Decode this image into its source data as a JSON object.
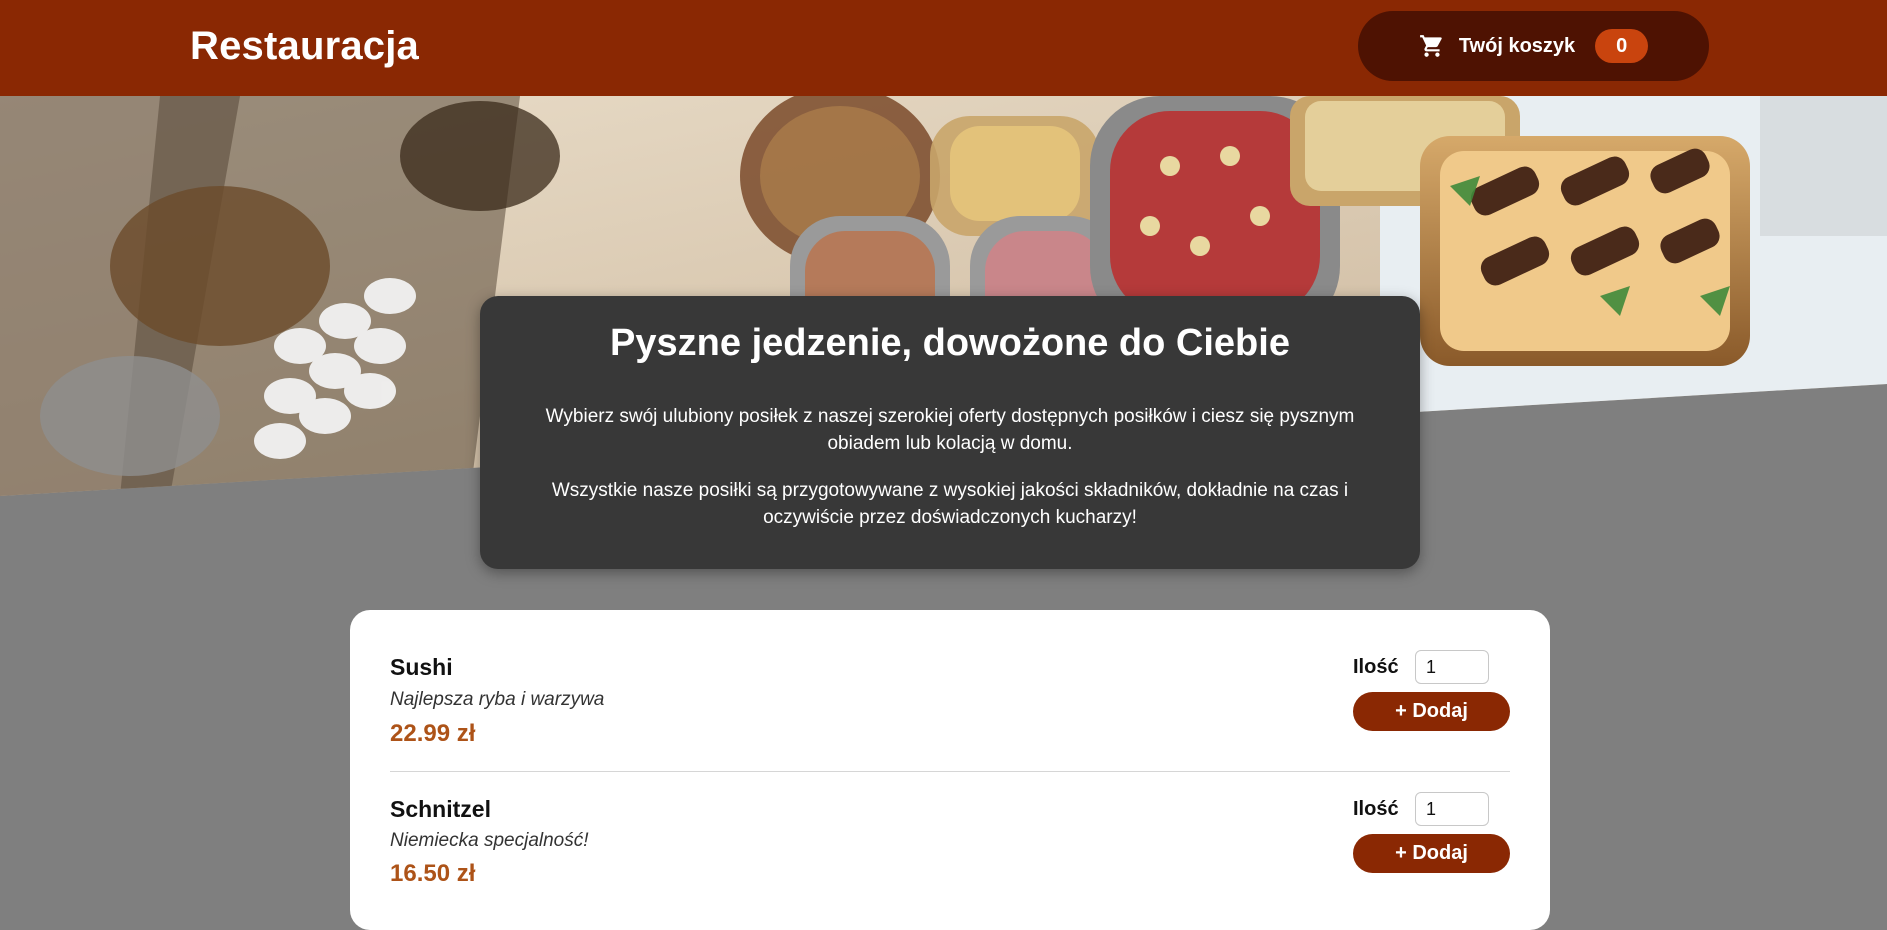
{
  "header": {
    "brand": "Restauracja",
    "cart": {
      "icon": "shopping-cart-icon",
      "label": "Twój koszyk",
      "count": "0"
    }
  },
  "hero": {
    "image": "catering-buffet-photo"
  },
  "intro": {
    "title": "Pyszne jedzenie, dowożone do Ciebie",
    "paragraph1": "Wybierz swój ulubiony posiłek z naszej szerokiej oferty dostępnych posiłków i ciesz się pysznym obiadem lub kolacją w domu.",
    "paragraph2": "Wszystkie nasze posiłki są przygotowywane z wysokiej jakości składników, dokładnie na czas i oczywiście przez doświadczonych kucharzy!"
  },
  "meals": [
    {
      "name": "Sushi",
      "description": "Najlepsza ryba i warzywa",
      "price": "22.99 zł",
      "qty_label": "Ilość",
      "qty_value": "1",
      "add_label": "+ Dodaj"
    },
    {
      "name": "Schnitzel",
      "description": "Niemiecka specjalność!",
      "price": "16.50 zł",
      "qty_label": "Ilość",
      "qty_value": "1",
      "add_label": "+ Dodaj"
    }
  ],
  "colors": {
    "header_bg": "#8a2803",
    "cart_bg": "#4e1202",
    "badge_bg": "#c9440e",
    "price": "#ad5318",
    "page_bg": "#7f7f7f",
    "intro_bg": "#383838"
  }
}
